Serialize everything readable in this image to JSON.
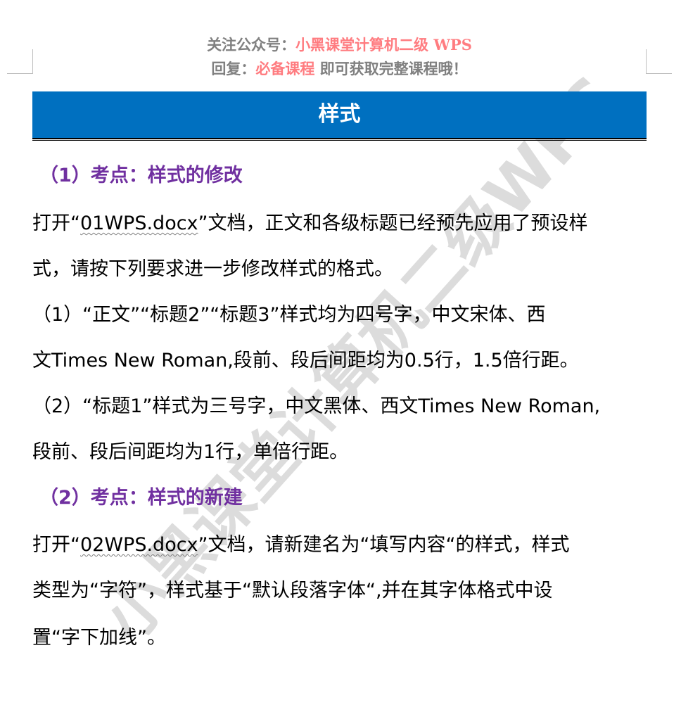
{
  "header": {
    "line1_label": "关注公众号：",
    "line1_highlight": "小黑课堂计算机二级 WPS",
    "line2_label": "回复：",
    "line2_highlight": "必备课程",
    "line2_rest": " 即可获取完整课程哦！"
  },
  "title": "样式",
  "watermark": "小黑课堂计算机二级WPS",
  "sections": [
    {
      "heading": "（1）考点：样式的修改",
      "lines": [
        {
          "pre": "打开“",
          "file": "01WPS.docx",
          "post": "”文档，正文和各级标题已经预先应用了预设样"
        },
        {
          "text": "式，请按下列要求进一步修改样式的格式。"
        },
        {
          "text": "（1）“正文”“标题2”“标题3”样式均为四号字，中文宋体、西"
        },
        {
          "text": "文Times New Roman,段前、段后间距均为0.5行，1.5倍行距。"
        },
        {
          "text": "（2）“标题1”样式为三号字，中文黑体、西文Times New Roman,"
        },
        {
          "text": "段前、段后间距均为1行，单倍行距。"
        }
      ]
    },
    {
      "heading": "（2）考点：样式的新建",
      "lines": [
        {
          "pre": "打开“",
          "file": "02WPS.docx",
          "post": "”文档，请新建名为“填写内容“的样式，样式"
        },
        {
          "text": "类型为“字符”，样式基于“默认段落字体“,并在其字体格式中设"
        },
        {
          "text": "置“字下加线”。"
        }
      ]
    }
  ],
  "colors": {
    "banner": "#0070c0",
    "heading": "#7030a0",
    "highlight": "#ff7c80",
    "header_gray": "#808080"
  }
}
